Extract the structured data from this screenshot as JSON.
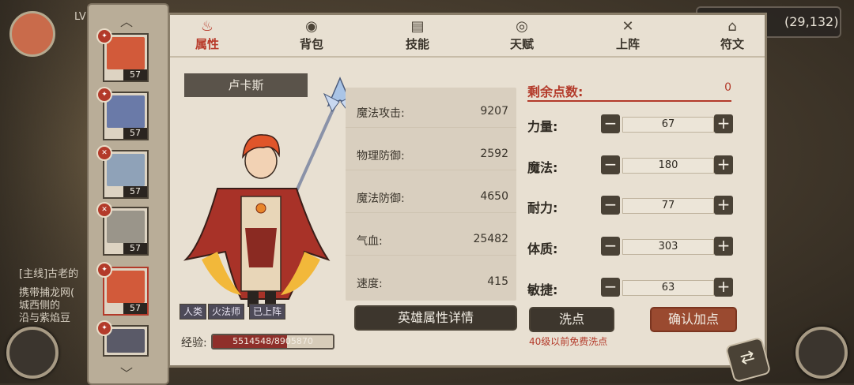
{
  "hud": {
    "coordinates": "(29,132)",
    "ghost_texts": [
      "LV",
      "[主线]古老的",
      "携带捕龙网(",
      "城西侧的",
      "沿与紫焰豆"
    ]
  },
  "roster": {
    "up_arrow": "︿",
    "down_arrow": "﹀",
    "heroes": [
      {
        "level": "57",
        "face_color": "#d25a3a",
        "selected": false
      },
      {
        "level": "57",
        "face_color": "#6a7aa8",
        "selected": false
      },
      {
        "level": "57",
        "face_color": "#8fa2b8",
        "selected": false
      },
      {
        "level": "57",
        "face_color": "#9a958a",
        "selected": false
      },
      {
        "level": "57",
        "face_color": "#d25a3a",
        "selected": true
      },
      {
        "level": "57",
        "face_color": "#5a5a68",
        "selected": false
      }
    ]
  },
  "tabs": [
    {
      "label": "属性",
      "icon": "flame-icon",
      "active": true
    },
    {
      "label": "背包",
      "icon": "bag-icon",
      "active": false
    },
    {
      "label": "技能",
      "icon": "book-icon",
      "active": false
    },
    {
      "label": "天赋",
      "icon": "eye-icon",
      "active": false
    },
    {
      "label": "上阵",
      "icon": "crossed-swords-icon",
      "active": false
    },
    {
      "label": "符文",
      "icon": "rune-icon",
      "active": false
    }
  ],
  "hero": {
    "name": "卢卡斯",
    "tags": [
      "人类",
      "火法师",
      "已上阵"
    ],
    "exp_label": "经验:",
    "exp_text": "5514548/8905870",
    "exp_current": 5514548,
    "exp_max": 8905870
  },
  "stats": [
    {
      "label": "魔法攻击:",
      "value": "9207"
    },
    {
      "label": "物理防御:",
      "value": "2592"
    },
    {
      "label": "魔法防御:",
      "value": "4650"
    },
    {
      "label": "气血:",
      "value": "25482"
    },
    {
      "label": "速度:",
      "value": "415"
    }
  ],
  "points": {
    "remaining_label": "剩余点数:",
    "remaining_value": "0",
    "attributes": [
      {
        "label": "力量:",
        "value": "67"
      },
      {
        "label": "魔法:",
        "value": "180"
      },
      {
        "label": "耐力:",
        "value": "77"
      },
      {
        "label": "体质:",
        "value": "303"
      },
      {
        "label": "敏捷:",
        "value": "63"
      }
    ],
    "minus_symbol": "−",
    "plus_symbol": "+"
  },
  "buttons": {
    "detail": "英雄属性详情",
    "wash": "洗点",
    "confirm": "确认加点",
    "wash_note": "40级以前免费洗点"
  }
}
